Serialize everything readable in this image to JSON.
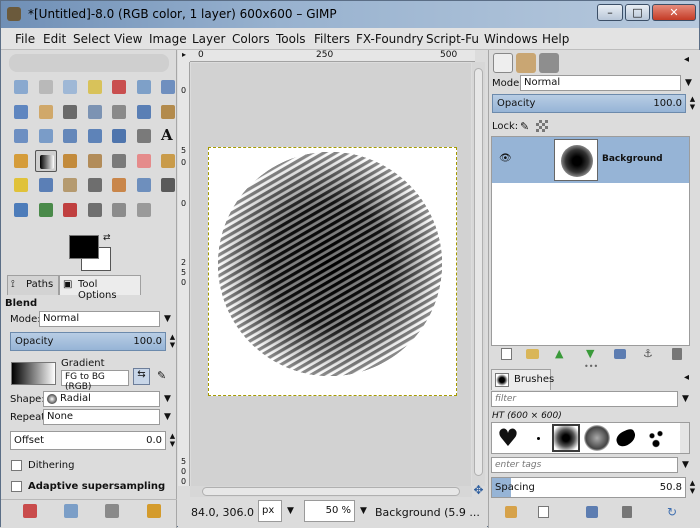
{
  "window": {
    "title": "*[Untitled]-8.0 (RGB color, 1 layer) 600x600 – GIMP",
    "minimize_label": "–",
    "maximize_label": "□",
    "close_label": "✕"
  },
  "menu": [
    "File",
    "Edit",
    "Select",
    "View",
    "Image",
    "Layer",
    "Colors",
    "Tools",
    "Filters",
    "FX-Foundry",
    "Script-Fu",
    "Windows",
    "Help"
  ],
  "tool_options": {
    "tabs": [
      "Paths",
      "Tool Options"
    ],
    "tool_name": "Blend",
    "mode_label": "Mode:",
    "mode_value": "Normal",
    "opacity_label": "Opacity",
    "opacity_value": "100.0",
    "gradient_label": "Gradient",
    "gradient_value": "FG to BG (RGB)",
    "shape_label": "Shape:",
    "shape_value": "Radial",
    "repeat_label": "Repeat:",
    "repeat_value": "None",
    "offset_label": "Offset",
    "offset_value": "0.0",
    "dithering_label": "Dithering",
    "adaptive_label": "Adaptive supersampling"
  },
  "rulers": {
    "top": [
      "0",
      "250",
      "500"
    ],
    "left": [
      "0",
      "5",
      "0",
      "0",
      "2",
      "5",
      "0",
      "5",
      "0",
      "0"
    ]
  },
  "status": {
    "coords": "84.0, 306.0",
    "unit": "px",
    "zoom": "50 %",
    "layer_info": "Background (5.9 ..."
  },
  "layers": {
    "mode_label": "Mode:",
    "mode_value": "Normal",
    "opacity_label": "Opacity",
    "opacity_value": "100.0",
    "lock_label": "Lock:",
    "layer_name": "Background"
  },
  "brushes": {
    "tab_label": "Brushes",
    "filter_placeholder": "filter",
    "brush_name": "HT (600 × 600)",
    "tags_placeholder": "enter tags",
    "spacing_label": "Spacing",
    "spacing_value": "50.8",
    "spacing_fraction": 0.1
  },
  "colors": {
    "selection_blue": "#96b4d6",
    "foreground": "#000000",
    "background": "#ffffff"
  },
  "icons": {
    "toolbox": [
      "rect-select-icon",
      "ellipse-select-icon",
      "free-select-icon",
      "fuzzy-select-icon",
      "color-select-icon",
      "scissors-select-icon",
      "foreground-select-icon",
      "paths-icon",
      "color-picker-icon",
      "zoom-icon",
      "measure-icon",
      "move-icon",
      "align-icon",
      "crop-icon",
      "rotate-icon",
      "scale-icon",
      "shear-icon",
      "perspective-icon",
      "flip-icon",
      "cage-icon",
      "text-icon",
      "bucket-fill-icon",
      "blend-icon",
      "paintbrush-icon",
      "pencil-icon",
      "airbrush-icon",
      "eraser-icon",
      "clone-icon",
      "heal-icon",
      "ink-icon",
      "smudge-icon",
      "dodge-burn-icon",
      "perspective-clone-icon",
      "convolve-icon",
      "curves-icon",
      "levels-icon",
      "color-balance-icon",
      "hue-saturation-icon",
      "threshold-icon",
      "warp-icon",
      "unified-transform-icon"
    ]
  }
}
